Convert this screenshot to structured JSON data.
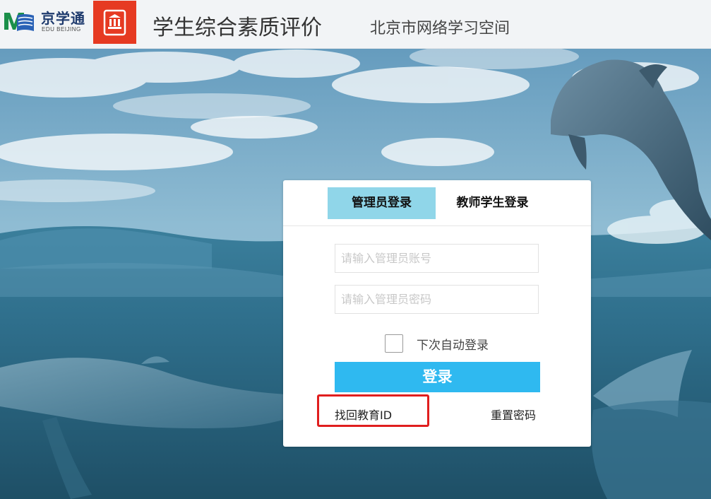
{
  "header": {
    "brand_name": "京学通",
    "brand_sub": "EDU BEIJING",
    "app_title": "学生综合素质评价",
    "app_subtitle": "北京市网络学习空间"
  },
  "login": {
    "tabs": [
      {
        "label": "管理员登录",
        "active": true
      },
      {
        "label": "教师学生登录",
        "active": false
      }
    ],
    "username_placeholder": "请输入管理员账号",
    "password_placeholder": "请输入管理员密码",
    "remember_label": "下次自动登录",
    "remember_checked": false,
    "submit_label": "登录",
    "find_id_label": "找回教育ID",
    "reset_password_label": "重置密码"
  },
  "colors": {
    "active_tab": "#90d6e9",
    "submit_button": "#2fb9f0",
    "highlight_box": "#e01e1e",
    "brand_red": "#e63a22"
  }
}
